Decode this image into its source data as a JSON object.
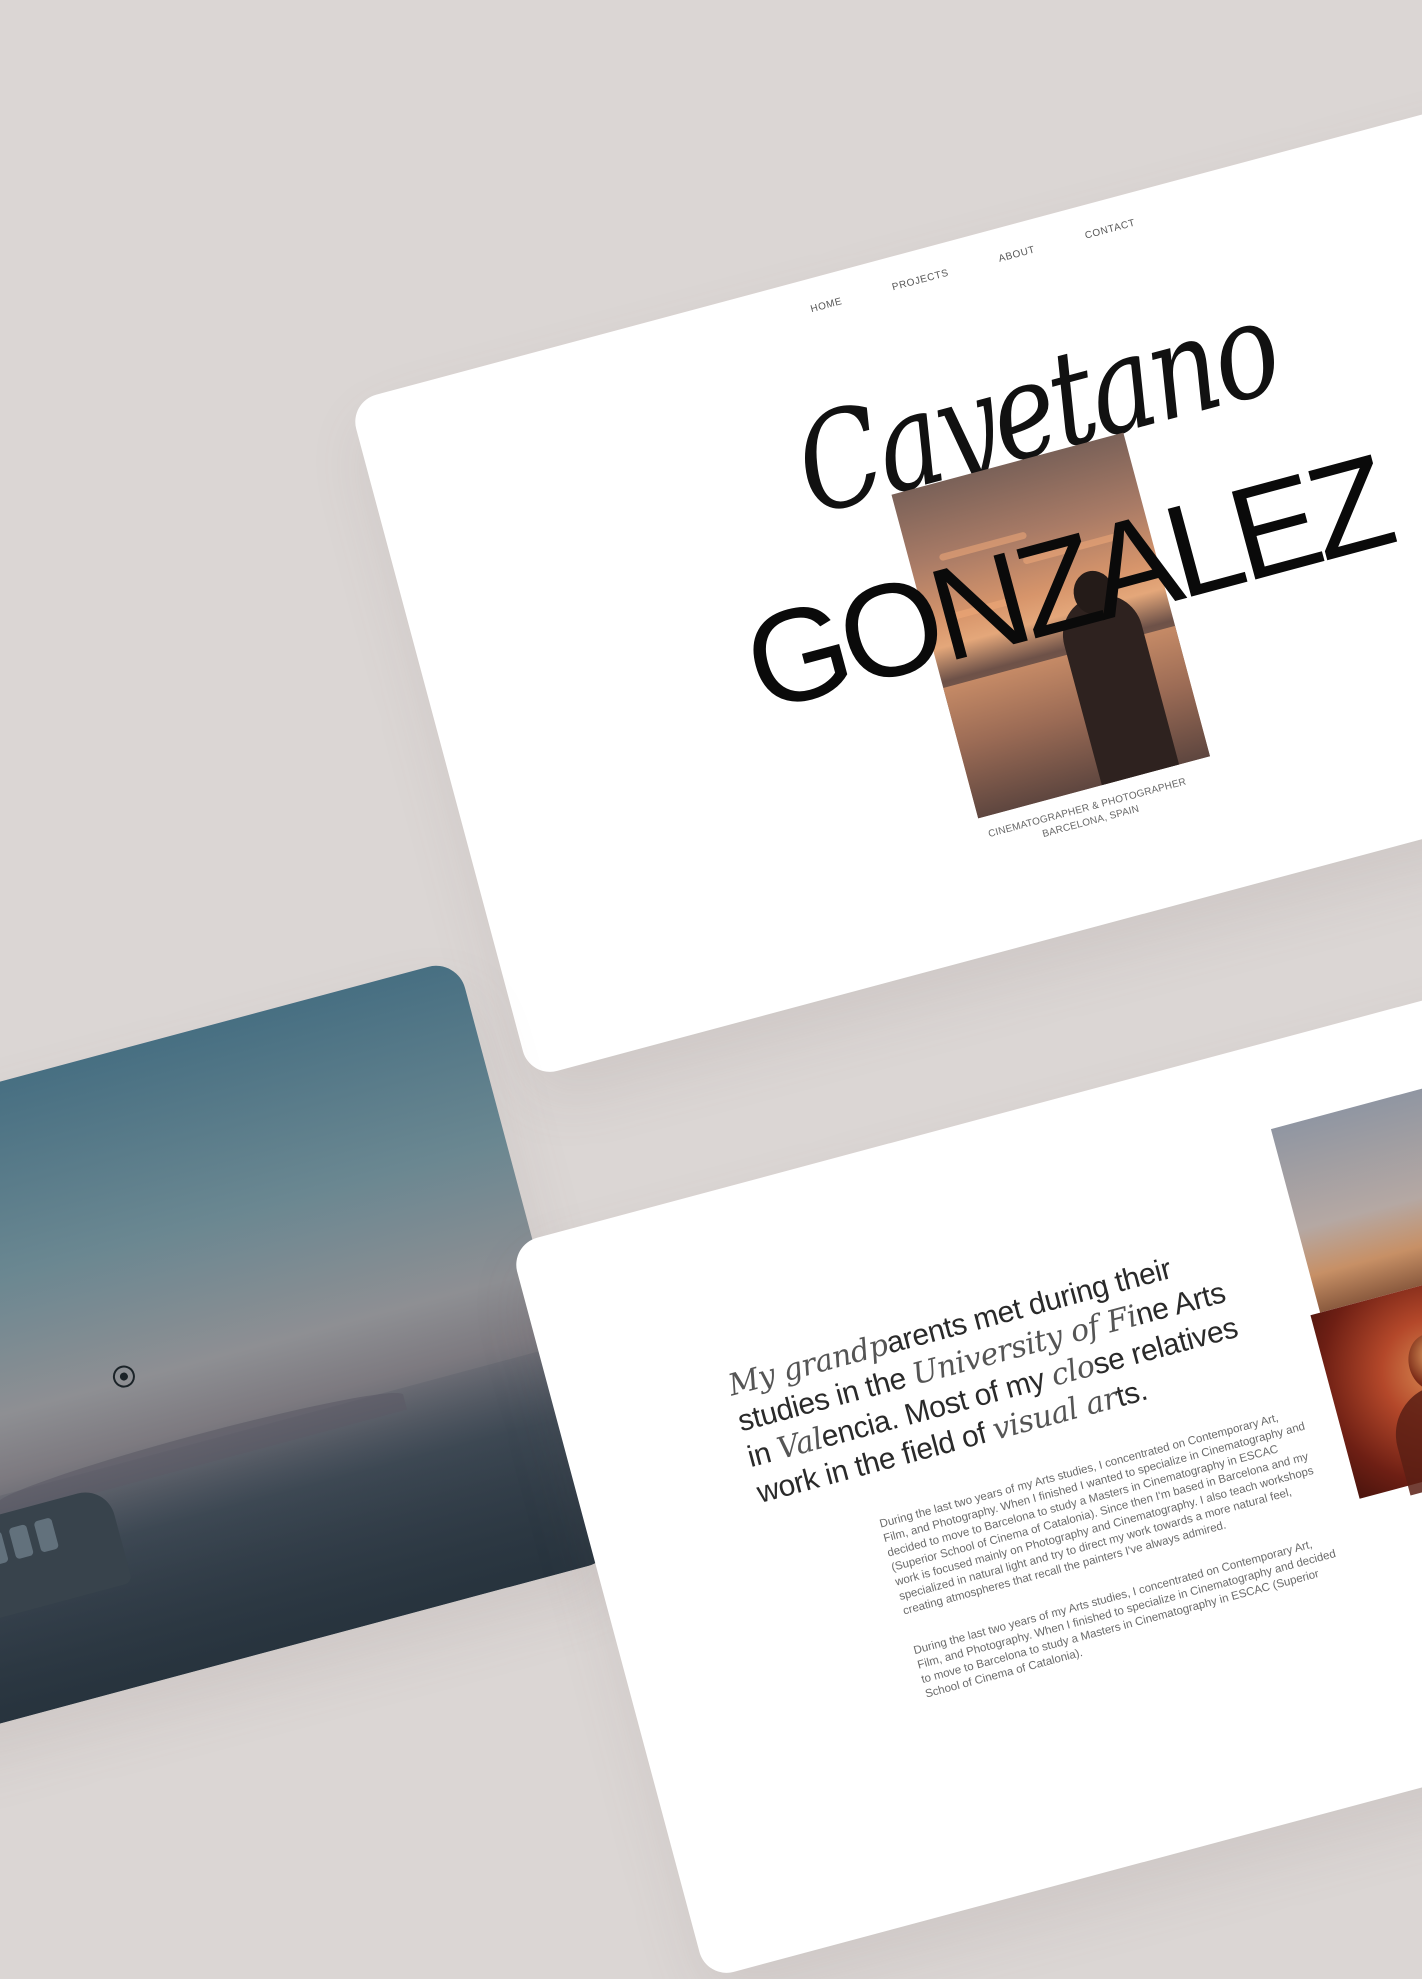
{
  "nav": {
    "home": "HOME",
    "projects": "PROJECTS",
    "about": "ABOUT",
    "contact": "CONTACT"
  },
  "hero": {
    "first_name": "Cayetano",
    "last_name": "GONZALEZ",
    "caption_line1": "CINEMATOGRAPHER & PHOTOGRAPHER",
    "caption_line2": "BARCELONA, SPAIN"
  },
  "about": {
    "heading_parts": [
      {
        "text": "My grandp",
        "italic": true
      },
      {
        "text": "arents met during their studies in the ",
        "italic": false
      },
      {
        "text": "University of Fi",
        "italic": true
      },
      {
        "text": "ne Arts in ",
        "italic": false
      },
      {
        "text": "Val",
        "italic": true
      },
      {
        "text": "encia. Most of my ",
        "italic": false
      },
      {
        "text": "clo",
        "italic": true
      },
      {
        "text": "se relatives work in the field of ",
        "italic": false
      },
      {
        "text": "visual ar",
        "italic": true
      },
      {
        "text": "ts.",
        "italic": false
      }
    ],
    "paragraph1": "During the last two years of my Arts studies, I concentrated on Contemporary Art, Film, and Photography. When I finished I wanted to specialize in Cinematography and decided to move to Barcelona to study a Masters in Cinematography in ESCAC (Superior School of Cinema of Catalonia). Since then I'm based in Barcelona and my work is focused mainly on Photography and Cinematography. I also teach workshops specialized in natural light and try to direct my work towards a more natural feel, creating atmospheres that recall the painters I've always admired.",
    "paragraph2": "During the last two years of my Arts studies, I concentrated on Contemporary Art, Film, and Photography. When I finished to specialize in Cinematography and decided to move to Barcelona to study a Masters in Cinematography in ESCAC (Superior School of Cinema of Catalonia)."
  }
}
